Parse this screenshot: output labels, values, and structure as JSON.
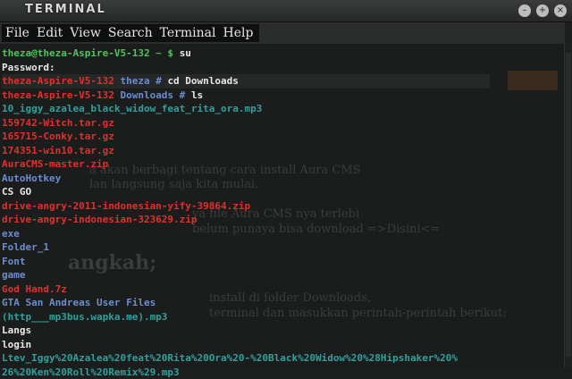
{
  "window": {
    "title": "TERMINAL",
    "buttons": [
      "–",
      "+",
      "×"
    ]
  },
  "menu": [
    "File",
    "Edit",
    "View",
    "Search",
    "Terminal",
    "Help"
  ],
  "colors": {
    "green": "#50c35a",
    "white": "#e8e8e8",
    "red": "#e0302c",
    "blue": "#6e8cd0",
    "cyan": "#2fa09c"
  },
  "background_article": {
    "lines": [
      "a akan berbagi tentang cara install Aura CMS",
      "lan langsung saja kita mulai.",
      "ya file Aura CMS nya terlebi",
      "belum punaya bisa download =>Disini<=",
      "angkah;",
      "install di folder Downloads,",
      "terminal dan masukkan perintah-perintah berikut:"
    ]
  },
  "terminal": {
    "lines": [
      {
        "segments": [
          {
            "t": "theza@theza-Aspire-V5-132 ~ $ ",
            "c": "green"
          },
          {
            "t": "su",
            "c": "white"
          }
        ]
      },
      {
        "segments": [
          {
            "t": "Password:",
            "c": "white"
          }
        ]
      },
      {
        "hl": true,
        "segments": [
          {
            "t": "theza-Aspire-V5-132 ",
            "c": "red"
          },
          {
            "t": "theza # ",
            "c": "blue"
          },
          {
            "t": "cd Downloads",
            "c": "white"
          }
        ]
      },
      {
        "segments": [
          {
            "t": "theza-Aspire-V5-132 ",
            "c": "red"
          },
          {
            "t": "Downloads # ",
            "c": "blue"
          },
          {
            "t": "ls",
            "c": "white"
          }
        ]
      },
      {
        "segments": [
          {
            "t": "10_iggy_azalea_black_widow_feat_rita_ora.mp3",
            "c": "cyan"
          }
        ]
      },
      {
        "segments": [
          {
            "t": "159742-Witch.tar.gz",
            "c": "red"
          }
        ]
      },
      {
        "segments": [
          {
            "t": "165715-Conky.tar.gz",
            "c": "red"
          }
        ]
      },
      {
        "segments": [
          {
            "t": "174351-win10.tar.gz",
            "c": "red"
          }
        ]
      },
      {
        "segments": [
          {
            "t": "AuraCMS-master.zip",
            "c": "red"
          }
        ]
      },
      {
        "segments": [
          {
            "t": "AutoHotkey",
            "c": "blue"
          }
        ]
      },
      {
        "segments": [
          {
            "t": "CS GO",
            "c": "white"
          }
        ]
      },
      {
        "segments": [
          {
            "t": "drive-angry-2011-indonesian-yify-39864.zip",
            "c": "red"
          }
        ]
      },
      {
        "segments": [
          {
            "t": "drive-angry-indonesian-323629.zip",
            "c": "red"
          }
        ]
      },
      {
        "segments": [
          {
            "t": "exe",
            "c": "blue"
          }
        ]
      },
      {
        "segments": [
          {
            "t": "Folder_1",
            "c": "blue"
          }
        ]
      },
      {
        "segments": [
          {
            "t": "Font",
            "c": "blue"
          }
        ]
      },
      {
        "segments": [
          {
            "t": "game",
            "c": "blue"
          }
        ]
      },
      {
        "segments": [
          {
            "t": "God Hand.7z",
            "c": "red"
          }
        ]
      },
      {
        "segments": [
          {
            "t": "GTA San Andreas User Files",
            "c": "blue"
          }
        ]
      },
      {
        "segments": [
          {
            "t": "(http___mp3bus.wapka.me).mp3",
            "c": "cyan"
          }
        ]
      },
      {
        "segments": [
          {
            "t": "Langs",
            "c": "white"
          }
        ]
      },
      {
        "segments": [
          {
            "t": "login",
            "c": "white"
          }
        ]
      },
      {
        "segments": [
          {
            "t": "Ltev_Iggy%20Azalea%20feat%20Rita%20Ora%20-%20Black%20Widow%20%28Hipshaker%20%",
            "c": "cyan"
          }
        ]
      },
      {
        "segments": [
          {
            "t": "26%20Ken%20Roll%20Remix%29.mp3",
            "c": "cyan"
          }
        ]
      }
    ]
  }
}
